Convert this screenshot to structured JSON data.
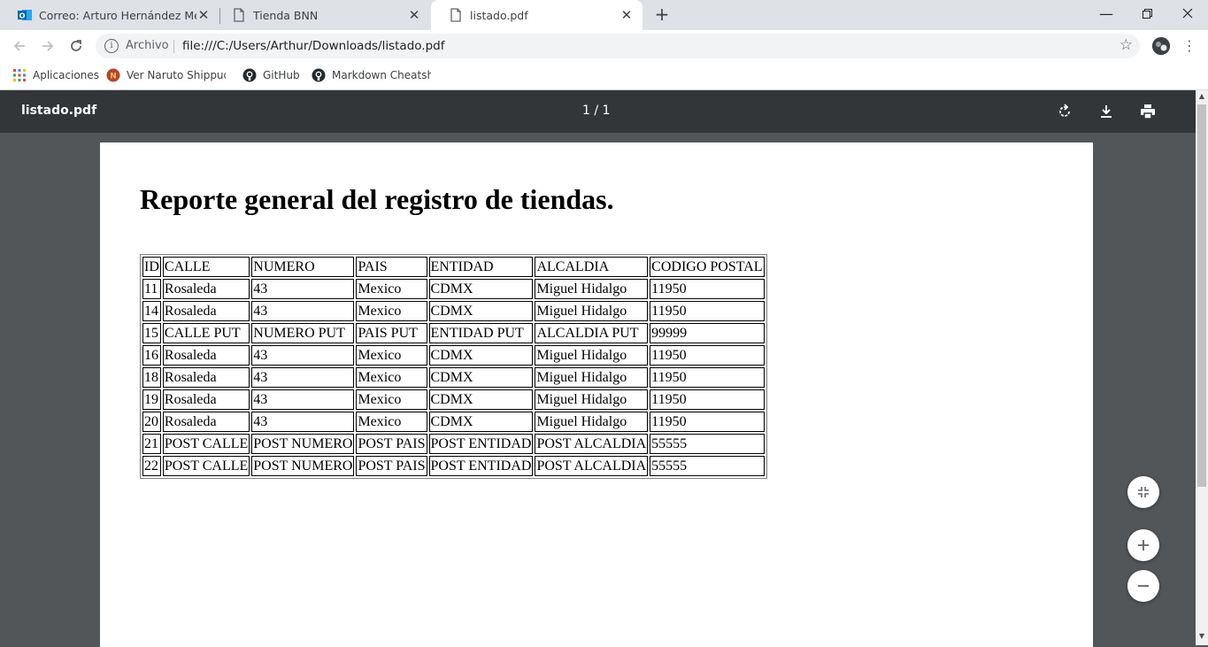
{
  "browser": {
    "tabs": [
      {
        "title": "Correo: Arturo Hernández Meder",
        "icon": "outlook-icon",
        "active": false
      },
      {
        "title": "Tienda BNN",
        "icon": "document-icon",
        "active": false
      },
      {
        "title": "listado.pdf",
        "icon": "document-icon",
        "active": true
      }
    ],
    "omnibox": {
      "chip": "Archivo",
      "url": "file:///C:/Users/Arthur/Downloads/listado.pdf"
    },
    "bookmarks": [
      {
        "label": "Aplicaciones",
        "icon": "apps-grid-icon"
      },
      {
        "label": "Ver Naruto Shippude",
        "icon": "naruto-site-icon"
      },
      {
        "label": "GitHub",
        "icon": "github-icon"
      },
      {
        "label": "Markdown Cheatshe",
        "icon": "github-icon"
      }
    ],
    "colors": {
      "tabstrip": "#dee1e6",
      "pdf_toolbar": "#323639",
      "viewer_bg": "#525659"
    }
  },
  "pdf": {
    "filename": "listado.pdf",
    "page_indicator": "1 / 1",
    "document_title": "Reporte general del registro de tiendas.",
    "table": {
      "headers": [
        "ID",
        "CALLE",
        "NUMERO",
        "PAIS",
        "ENTIDAD",
        "ALCALDIA",
        "CODIGO POSTAL"
      ],
      "rows": [
        [
          "11",
          "Rosaleda",
          "43",
          "Mexico",
          "CDMX",
          "Miguel Hidalgo",
          "11950"
        ],
        [
          "14",
          "Rosaleda",
          "43",
          "Mexico",
          "CDMX",
          "Miguel Hidalgo",
          "11950"
        ],
        [
          "15",
          "CALLE PUT",
          "NUMERO PUT",
          "PAIS PUT",
          "ENTIDAD PUT",
          "ALCALDIA PUT",
          "99999"
        ],
        [
          "16",
          "Rosaleda",
          "43",
          "Mexico",
          "CDMX",
          "Miguel Hidalgo",
          "11950"
        ],
        [
          "18",
          "Rosaleda",
          "43",
          "Mexico",
          "CDMX",
          "Miguel Hidalgo",
          "11950"
        ],
        [
          "19",
          "Rosaleda",
          "43",
          "Mexico",
          "CDMX",
          "Miguel Hidalgo",
          "11950"
        ],
        [
          "20",
          "Rosaleda",
          "43",
          "Mexico",
          "CDMX",
          "Miguel Hidalgo",
          "11950"
        ],
        [
          "21",
          "POST CALLE",
          "POST NUMERO",
          "POST PAIS",
          "POST ENTIDAD",
          "POST ALCALDIA",
          "55555"
        ],
        [
          "22",
          "POST CALLE",
          "POST NUMERO",
          "POST PAIS",
          "POST ENTIDAD",
          "POST ALCALDIA",
          "55555"
        ]
      ]
    }
  }
}
